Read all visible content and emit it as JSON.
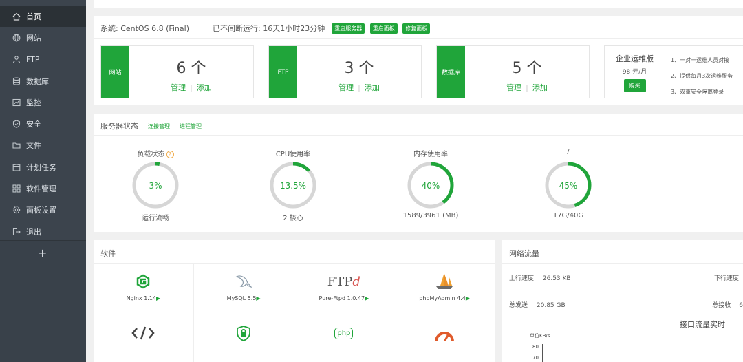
{
  "sidebar": {
    "items": [
      {
        "label": "首页",
        "icon": "home-icon",
        "active": true
      },
      {
        "label": "网站",
        "icon": "globe-icon"
      },
      {
        "label": "FTP",
        "icon": "user-icon"
      },
      {
        "label": "数据库",
        "icon": "database-icon"
      },
      {
        "label": "监控",
        "icon": "monitor-icon"
      },
      {
        "label": "安全",
        "icon": "shield-icon"
      },
      {
        "label": "文件",
        "icon": "folder-icon"
      },
      {
        "label": "计划任务",
        "icon": "calendar-icon"
      },
      {
        "label": "软件管理",
        "icon": "grid-icon"
      },
      {
        "label": "面板设置",
        "icon": "gear-icon"
      },
      {
        "label": "退出",
        "icon": "logout-icon"
      }
    ],
    "add": "+"
  },
  "system": {
    "os": "系统: CentOS 6.8 (Final)",
    "uptime": "已不间断运行: 16天1小时23分钟",
    "buttons": [
      "重启服务器",
      "重启面板",
      "修复面板"
    ]
  },
  "cards": [
    {
      "label": "网站",
      "count": "6 个",
      "manage": "管理",
      "add": "添加"
    },
    {
      "label": "FTP",
      "count": "3 个",
      "manage": "管理",
      "add": "添加"
    },
    {
      "label": "数据库",
      "count": "5 个",
      "manage": "管理",
      "add": "添加"
    }
  ],
  "vip": {
    "name": "企业运维版",
    "price": "98 元/月",
    "buy": "购买",
    "features": [
      "1、一对一运维人员对接",
      "2、提供每月3次运维服务",
      "3、双重安全隔离登录"
    ]
  },
  "status": {
    "title": "服务器状态",
    "links": [
      "连接管理",
      "进程管理"
    ],
    "gauges": [
      {
        "title": "负载状态",
        "help": "?",
        "value": "3%",
        "fraction": 0.03,
        "footer": "运行流畅"
      },
      {
        "title": "CPU使用率",
        "value": "13.5%",
        "fraction": 0.135,
        "footer": "2 核心"
      },
      {
        "title": "内存使用率",
        "value": "40%",
        "fraction": 0.4,
        "footer": "1589/3961 (MB)"
      },
      {
        "title": "/",
        "value": "45%",
        "fraction": 0.45,
        "footer": "17G/40G"
      }
    ]
  },
  "software": {
    "title": "软件",
    "items": [
      {
        "name": "Nginx 1.14",
        "arrow": "▶",
        "logo": "nginx-logo-icon"
      },
      {
        "name": "MySQL 5.5",
        "arrow": "▶",
        "logo": "mysql-dolphin-icon"
      },
      {
        "name": "Pure-Ftpd 1.0.47",
        "arrow": "▶",
        "logo_text": "FTP",
        "logo_suffix": "d"
      },
      {
        "name": "phpMyAdmin 4.4",
        "arrow": "▶",
        "logo": "sailboat-icon"
      }
    ],
    "row2_logos": [
      "code-icon",
      "lock-icon",
      "php-icon",
      "compass-icon"
    ],
    "row2_php": "php"
  },
  "network": {
    "title": "网络流量",
    "up_speed_label": "上行速度",
    "up_speed": "26.53 KB",
    "down_speed_label": "下行速度",
    "total_sent_label": "总发送",
    "total_sent": "20.85 GB",
    "total_recv_label": "总接收",
    "total_recv": "6",
    "chart_title": "接口流量实时",
    "unit": "单位KB/s",
    "ticks": [
      "80",
      "70"
    ]
  },
  "colors": {
    "accent": "#20a53a",
    "sidebar": "#3c444d",
    "warn": "#f0ad4e"
  }
}
